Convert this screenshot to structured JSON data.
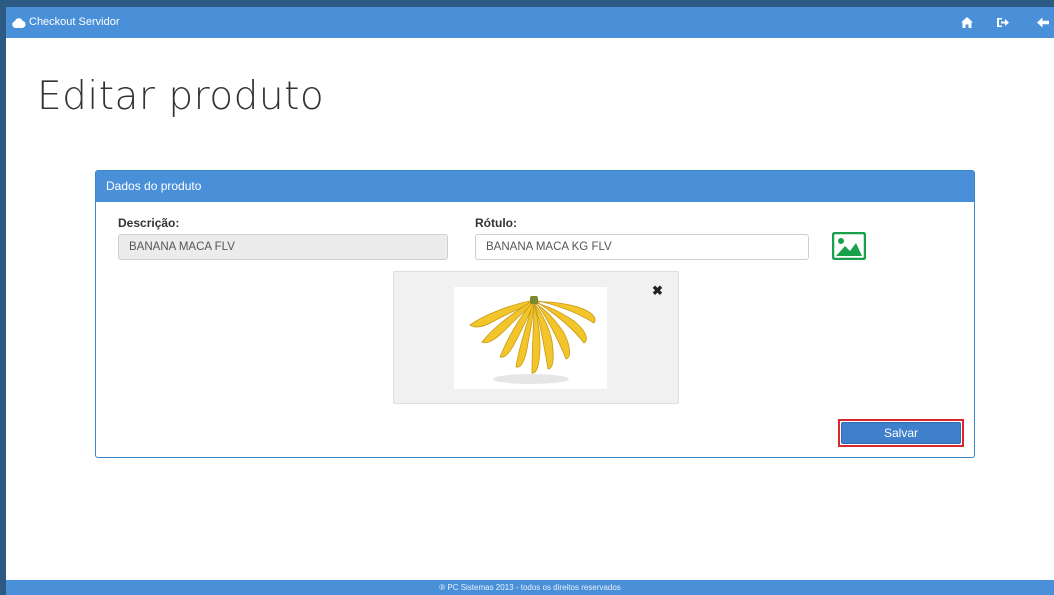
{
  "topbar": {
    "app_title": "Checkout Servidor",
    "icons": [
      "home-icon",
      "sign-out-icon",
      "arrow-back-icon"
    ]
  },
  "page": {
    "title": "Editar produto"
  },
  "panel": {
    "heading": "Dados do produto",
    "descricao_label": "Descrição:",
    "descricao_value": "BANANA MACA FLV",
    "rotulo_label": "Rótulo:",
    "rotulo_value": "BANANA MACA KG FLV",
    "image_button_icon": "image-icon",
    "remove_image_icon": "close-icon",
    "save_label": "Salvar"
  },
  "footer": {
    "text": "® PC Sistemas 2013 - todos os direitos reservados"
  },
  "colors": {
    "primary": "#4a90d9",
    "highlight": "#d9262f",
    "image_button": "#1aa04a"
  }
}
